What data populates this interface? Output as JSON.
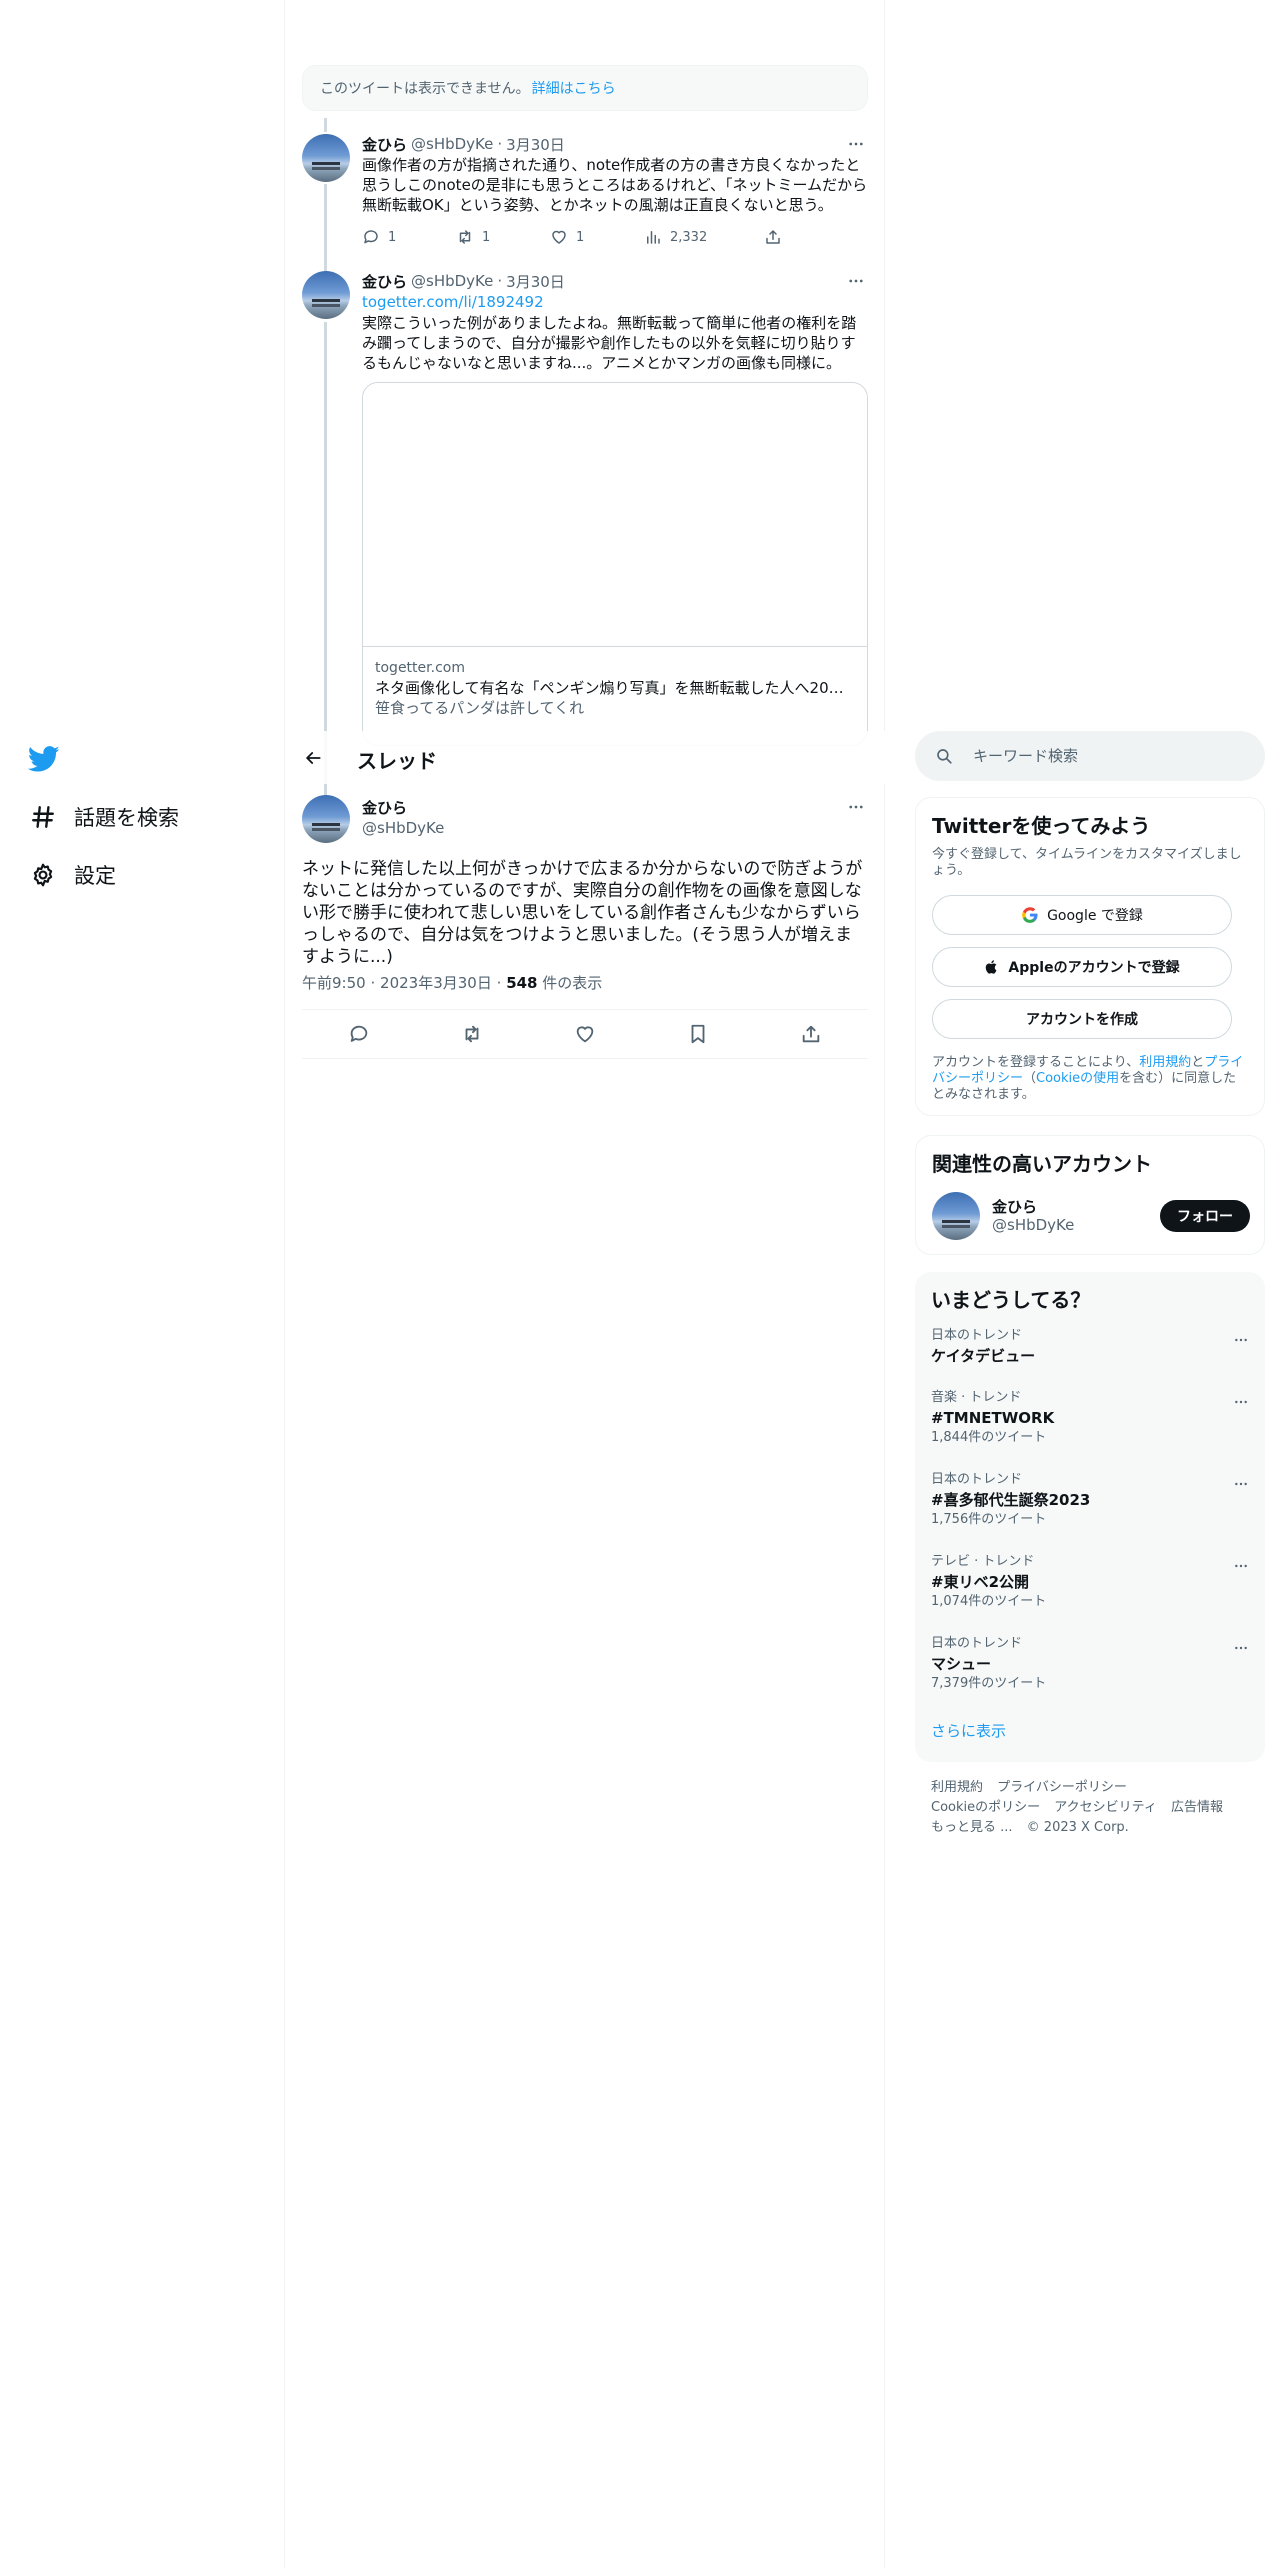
{
  "nav": {
    "items": [
      {
        "label": "話題を検索",
        "icon": "hashtag-icon"
      },
      {
        "label": "設定",
        "icon": "gear-icon"
      }
    ]
  },
  "thread": {
    "header_title": "スレッド",
    "unavailable": {
      "text": "このツイートは表示できません。",
      "link": "詳細はこちら"
    },
    "replies": [
      {
        "name": "金ひら",
        "handle": "@sHbDyKe",
        "dot": "·",
        "date": "3月30日",
        "text": "画像作者の方が指摘された通り、note作成者の方の書き方良くなかったと思うしこのnoteの是非にも思うところはあるけれど、「ネットミームだから無断転載OK」という姿勢、とかネットの風潮は正直良くないと思う。",
        "reply_count": "1",
        "retweet_count": "1",
        "like_count": "1",
        "view_count": "2,332"
      },
      {
        "name": "金ひら",
        "handle": "@sHbDyKe",
        "dot": "·",
        "date": "3月30日",
        "link": "togetter.com/li/1892492",
        "text": "実際こういった例がありましたよね。無断転載って簡単に他者の権利を踏み躙ってしまうので、自分が撮影や創作したもの以外を気軽に切り貼りするもんじゃないなと思いますね...。アニメとかマンガの画像も同様に。",
        "card": {
          "domain": "togetter.com",
          "title": "ネタ画像化して有名な「ペンギン煽り写真」を無断転載した人へ20万...",
          "description": "笹食ってるパンダは許してくれ"
        }
      }
    ],
    "main_tweet": {
      "name": "金ひら",
      "handle": "@sHbDyKe",
      "text": "ネットに発信した以上何がきっかけで広まるか分からないので防ぎようがないことは分かっているのですが、実際自分の創作物をの画像を意図しない形で勝手に使われて悲しい思いをしている創作者さんも少なからずいらっしゃるので、自分は気をつけようと思いました。(そう思う人が増えますように...)",
      "time": "午前9:50",
      "dot": "·",
      "date": "2023年3月30日",
      "views_num": "548",
      "views_label": " 件の表示"
    }
  },
  "sidebar": {
    "search_placeholder": "キーワード検索",
    "signup": {
      "title": "Twitterを使ってみよう",
      "subtitle": "今すぐ登録して、タイムラインをカスタマイズしましょう。",
      "google_button": "Google で登録",
      "apple_button": "Appleのアカウントで登録",
      "create_button": "アカウントを作成",
      "legal_1": "アカウントを登録することにより、",
      "legal_terms": "利用規約",
      "legal_2": "と",
      "legal_privacy": "プライバシーポリシー",
      "legal_3": "（",
      "legal_cookie": "Cookieの使用",
      "legal_4": "を含む）に同意したとみなされます。"
    },
    "relevant": {
      "title": "関連性の高いアカウント",
      "name": "金ひら",
      "handle": "@sHbDyKe",
      "follow_button": "フォロー"
    },
    "trends": {
      "title": "いまどうしてる？",
      "items": [
        {
          "category": "日本のトレンド",
          "name": "ケイタデビュー",
          "count": ""
        },
        {
          "category": "音楽 · トレンド",
          "name": "#TMNETWORK",
          "count": "1,844件のツイート"
        },
        {
          "category": "日本のトレンド",
          "name": "#喜多郁代生誕祭2023",
          "count": "1,756件のツイート"
        },
        {
          "category": "テレビ · トレンド",
          "name": "#東リベ2公開",
          "count": "1,074件のツイート"
        },
        {
          "category": "日本のトレンド",
          "name": "マシュー",
          "count": "7,379件のツイート"
        }
      ],
      "show_more": "さらに表示"
    },
    "footer": {
      "terms": "利用規約",
      "privacy": "プライバシーポリシー",
      "cookie": "Cookieのポリシー",
      "accessibility": "アクセシビリティ",
      "ads": "広告情報",
      "more": "もっと見る ...",
      "copyright": "© 2023 X Corp."
    }
  },
  "colors": {
    "accent": "#1d9bf0",
    "text": "#0f1419",
    "secondary": "#536471",
    "border": "#eff3f4"
  }
}
